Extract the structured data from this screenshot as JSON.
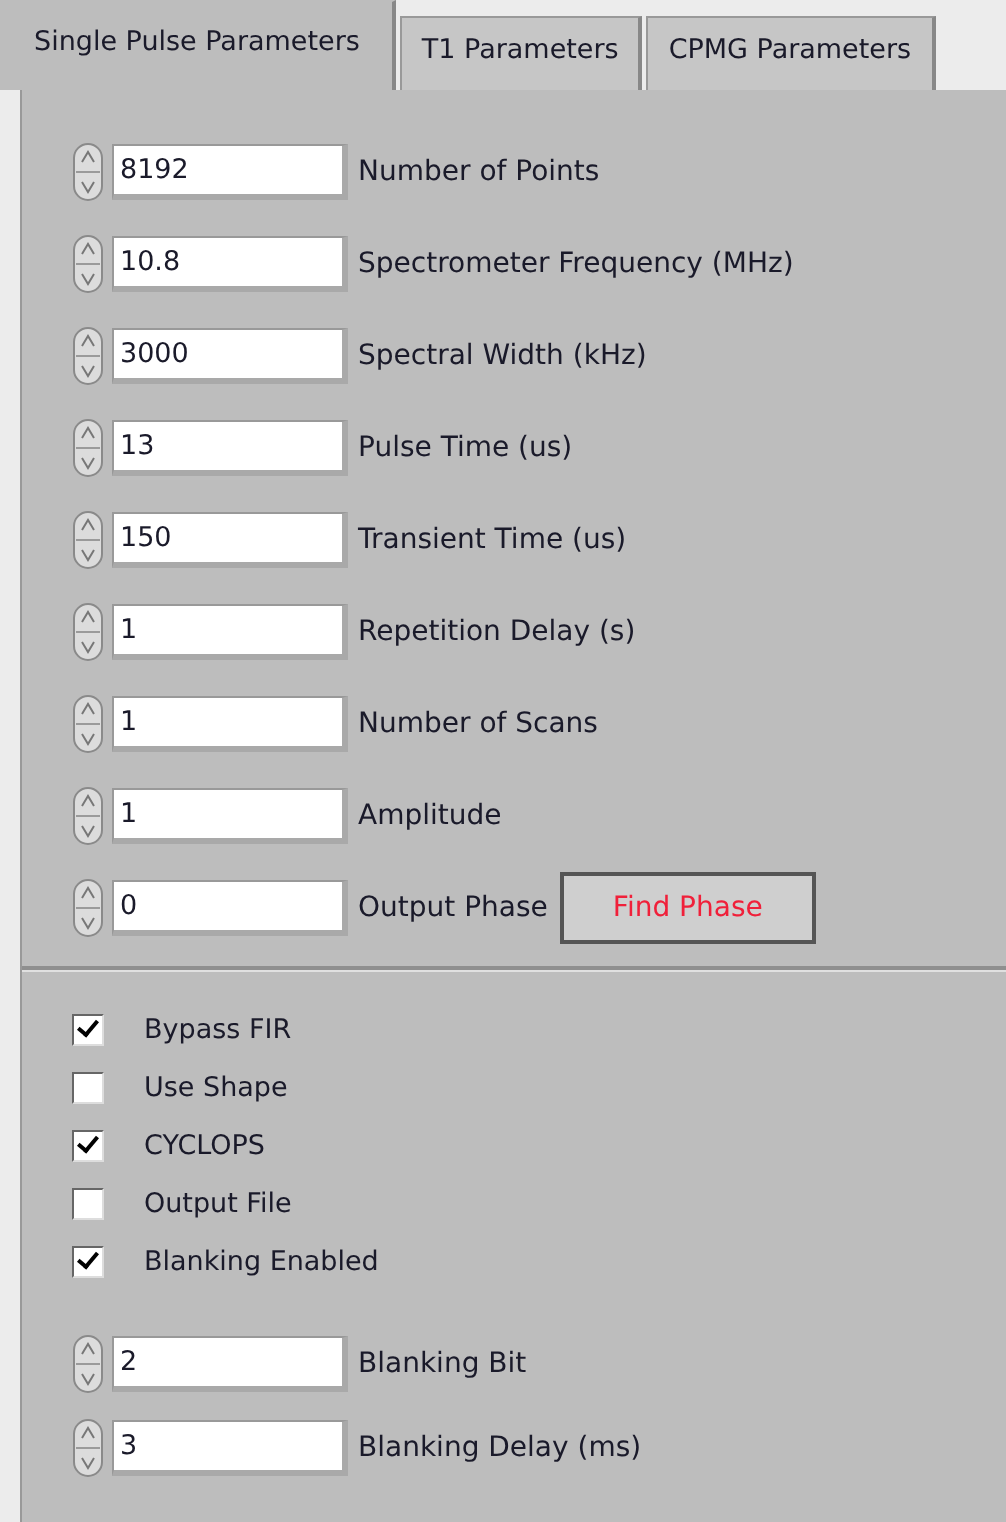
{
  "tabs": [
    {
      "label": "Single Pulse Parameters",
      "selected": true
    },
    {
      "label": "T1 Parameters",
      "selected": false
    },
    {
      "label": "CPMG  Parameters",
      "selected": false
    }
  ],
  "parameters": [
    {
      "value": "8192",
      "label": "Number of Points"
    },
    {
      "value": "10.8",
      "label": "Spectrometer Frequency (MHz)"
    },
    {
      "value": "3000",
      "label": "Spectral Width (kHz)"
    },
    {
      "value": "13",
      "label": "Pulse Time (us)"
    },
    {
      "value": "150",
      "label": "Transient Time (us)"
    },
    {
      "value": "1",
      "label": "Repetition Delay (s)"
    },
    {
      "value": "1",
      "label": "Number of Scans"
    },
    {
      "value": "1",
      "label": "Amplitude"
    },
    {
      "value": "0",
      "label": "Output Phase",
      "button": "Find Phase"
    }
  ],
  "options": [
    {
      "label": "Bypass FIR",
      "checked": true
    },
    {
      "label": "Use Shape",
      "checked": false
    },
    {
      "label": "CYCLOPS",
      "checked": true
    },
    {
      "label": "Output File",
      "checked": false
    },
    {
      "label": "Blanking Enabled",
      "checked": true
    }
  ],
  "blanking": [
    {
      "value": "2",
      "label": "Blanking Bit"
    },
    {
      "value": "3",
      "label": "Blanking Delay (ms)"
    }
  ]
}
